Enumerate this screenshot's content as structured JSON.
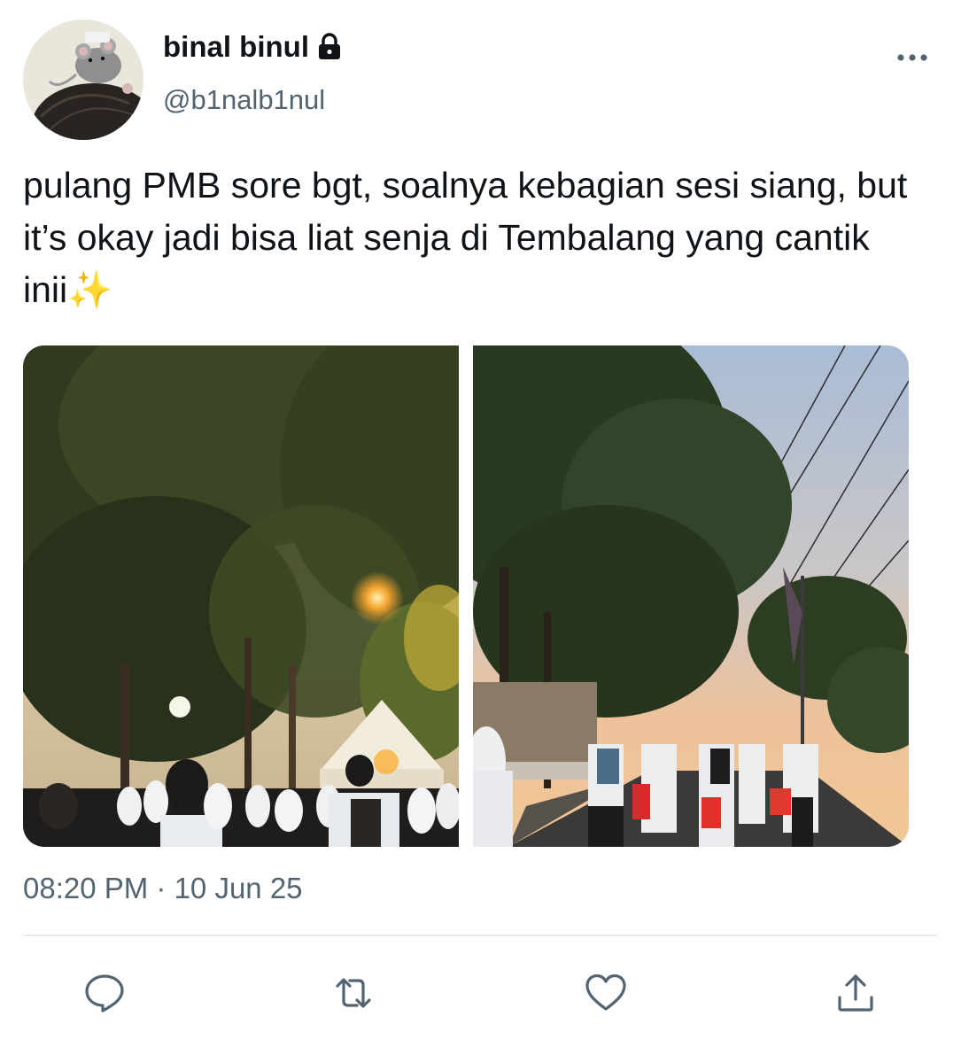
{
  "user": {
    "display_name": "binal binul",
    "handle": "@b1nalb1nul",
    "protected": true
  },
  "tweet": {
    "text": "pulang PMB sore bgt, soalnya kebagian sesi siang, but it’s okay jadi bisa liat senja di Tembalang yang cantik inii✨",
    "timestamp": "08:20 PM · 10 Jun 25",
    "photo_count": 2
  },
  "icons": {
    "more": "more-horizontal-icon",
    "lock": "lock-icon",
    "reply": "reply-icon",
    "retweet": "retweet-icon",
    "like": "heart-icon",
    "share": "share-icon"
  },
  "colors": {
    "text": "#0f1419",
    "secondary": "#536471",
    "divider": "#e6e8ea"
  }
}
